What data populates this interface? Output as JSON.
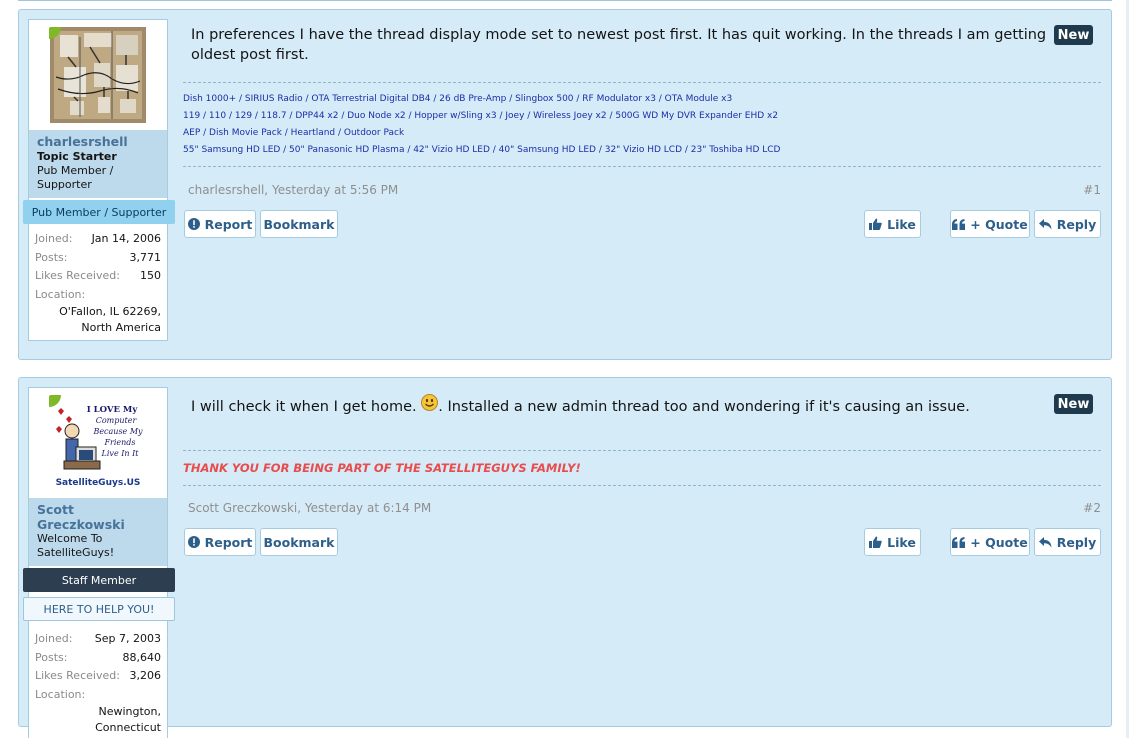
{
  "posts": [
    {
      "user": {
        "name": "charlesrshell",
        "starter": "Topic Starter",
        "title": "Pub Member / Supporter",
        "banners": [
          "Pub Member / Supporter"
        ],
        "joined_label": "Joined:",
        "joined": "Jan 14, 2006",
        "posts_label": "Posts:",
        "posts": "3,771",
        "likes_label": "Likes Received:",
        "likes": "150",
        "location_label": "Location:",
        "location": "O'Fallon, IL 62269, North America"
      },
      "message": "In preferences I have the thread display mode set to newest post first. It has quit working. In the threads I am getting oldest post first.",
      "badge": "New",
      "signature": [
        "Dish 1000+ / SIRIUS Radio / OTA Terrestrial Digital DB4 / 26 dB Pre-Amp / Slingbox 500 / RF Modulator x3 / OTA Module x3",
        "119 / 110 / 129 / 118.7 / DPP44 x2 / Duo Node x2 / Hopper w/Sling x3 / Joey / Wireless Joey x2 / 500G WD My DVR Expander EHD x2",
        "AEP / Dish Movie Pack / Heartland / Outdoor Pack",
        "55\" Samsung HD LED / 50\" Panasonic HD Plasma / 42\" Vizio HD LED / 40\" Samsung HD LED / 32\" Vizio HD LCD / 23\" Toshiba HD LCD"
      ],
      "meta_author": "charlesrshell,",
      "meta_time": "Yesterday at 5:56 PM",
      "permalink": "#1"
    },
    {
      "user": {
        "name": "Scott Greczkowski",
        "title": "Welcome To SatelliteGuys!",
        "banners": [
          "Staff Member",
          "HERE TO HELP YOU!"
        ],
        "joined_label": "Joined:",
        "joined": "Sep 7, 2003",
        "posts_label": "Posts:",
        "posts": "88,640",
        "likes_label": "Likes Received:",
        "likes": "3,206",
        "location_label": "Location:",
        "location": "Newington, Connecticut"
      },
      "message_before": "I will check it when I get home.",
      "message_after": ". Installed a new admin thread too and wondering if it's causing an issue.",
      "badge": "New",
      "signature": "THANK YOU FOR BEING PART OF THE SATELLITEGUYS FAMILY!",
      "meta_author": "Scott Greczkowski,",
      "meta_time": "Yesterday at 6:14 PM",
      "permalink": "#2"
    }
  ],
  "buttons": {
    "report": "Report",
    "bookmark": "Bookmark",
    "like": "Like",
    "quote": "+ Quote",
    "reply": "Reply"
  },
  "avatar2_text": [
    "I LOVE My",
    "Computer",
    "Because My",
    "Friends",
    "Live In It",
    "SatelliteGuys.US"
  ],
  "icons": {
    "report": "warning-circle-icon",
    "like": "thumbs-up-icon",
    "quote": "quote-icon",
    "reply": "reply-arrow-icon",
    "smiley": "smiley-icon"
  },
  "colors": {
    "post_bg": "#d6ebf8",
    "accent": "#2d5f8b",
    "new_badge": "#1f3a4d",
    "staff_banner": "#2c3e50",
    "signature_red": "#e84c4c",
    "signature_blue": "#1a2fa8"
  }
}
